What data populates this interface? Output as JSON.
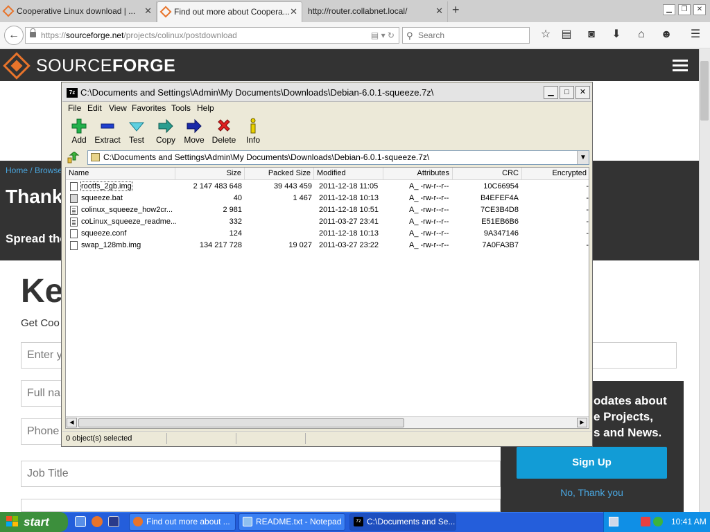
{
  "browser": {
    "tabs": [
      {
        "label": "Cooperative Linux download | ...",
        "active": false
      },
      {
        "label": "Find out more about Coopera...",
        "active": true
      },
      {
        "label": "http://router.collabnet.local/",
        "active": false
      }
    ],
    "url_prefix": "https://",
    "url_host": "sourceforge.net",
    "url_path": "/projects/colinux/postdownload",
    "search_placeholder": "Search"
  },
  "sourceforge": {
    "logo_left": "SOURCE",
    "logo_right": "FORGE",
    "breadcrumb": "Home / Browse",
    "heading_fragment": "Thank",
    "spread_fragment": "Spread the",
    "big_fragment": "Ke",
    "get_fragment": "Get Coo",
    "input_fragments": [
      "Enter y",
      "Full nar",
      "Phone",
      "Job Title"
    ],
    "promo_lines": [
      "odates about",
      "e Projects,",
      "s and News."
    ],
    "signup_label": "Sign Up",
    "no_thanks_label": "No, Thank you"
  },
  "sevenzip": {
    "title": "C:\\Documents and Settings\\Admin\\My Documents\\Downloads\\Debian-6.0.1-squeeze.7z\\",
    "menu": [
      "File",
      "Edit",
      "View",
      "Favorites",
      "Tools",
      "Help"
    ],
    "toolbar": [
      "Add",
      "Extract",
      "Test",
      "Copy",
      "Move",
      "Delete",
      "Info"
    ],
    "address": "C:\\Documents and Settings\\Admin\\My Documents\\Downloads\\Debian-6.0.1-squeeze.7z\\",
    "columns": [
      "Name",
      "Size",
      "Packed Size",
      "Modified",
      "Attributes",
      "CRC",
      "Encrypted"
    ],
    "rows": [
      {
        "name": "rootfs_2gb.img",
        "size": "2 147 483 648",
        "packed": "39 443 459",
        "modified": "2011-12-18 11:05",
        "attr": "A_ -rw-r--r--",
        "crc": "10C66954",
        "enc": "-",
        "icon": "img"
      },
      {
        "name": "squeeze.bat",
        "size": "40",
        "packed": "1 467",
        "modified": "2011-12-18 10:13",
        "attr": "A_ -rw-r--r--",
        "crc": "B4EFEF4A",
        "enc": "-",
        "icon": "bat"
      },
      {
        "name": "colinux_squeeze_how2cr...",
        "size": "2 981",
        "packed": "",
        "modified": "2011-12-18 10:51",
        "attr": "A_ -rw-r--r--",
        "crc": "7CE3B4D8",
        "enc": "-",
        "icon": "doc"
      },
      {
        "name": "coLinux_squeeze_readme...",
        "size": "332",
        "packed": "",
        "modified": "2011-03-27 23:41",
        "attr": "A_ -rw-r--r--",
        "crc": "E51EB6B6",
        "enc": "-",
        "icon": "doc"
      },
      {
        "name": "squeeze.conf",
        "size": "124",
        "packed": "",
        "modified": "2011-12-18 10:13",
        "attr": "A_ -rw-r--r--",
        "crc": "9A347146",
        "enc": "-",
        "icon": "img"
      },
      {
        "name": "swap_128mb.img",
        "size": "134 217 728",
        "packed": "19 027",
        "modified": "2011-03-27 23:22",
        "attr": "A_ -rw-r--r--",
        "crc": "7A0FA3B7",
        "enc": "-",
        "icon": "img"
      }
    ],
    "status": "0 object(s) selected"
  },
  "taskbar": {
    "start_label": "start",
    "items": [
      {
        "label": "Find out more about ...",
        "active": false
      },
      {
        "label": "README.txt - Notepad",
        "active": false
      },
      {
        "label": "C:\\Documents and Se...",
        "active": true
      }
    ],
    "clock": "10:41 AM"
  },
  "colors": {
    "sf_dark": "#333333",
    "sf_orange": "#e8742b",
    "sf_blue": "#129cd6",
    "xp_taskbar": "#245edb",
    "xp_start": "#3c8f3c"
  }
}
